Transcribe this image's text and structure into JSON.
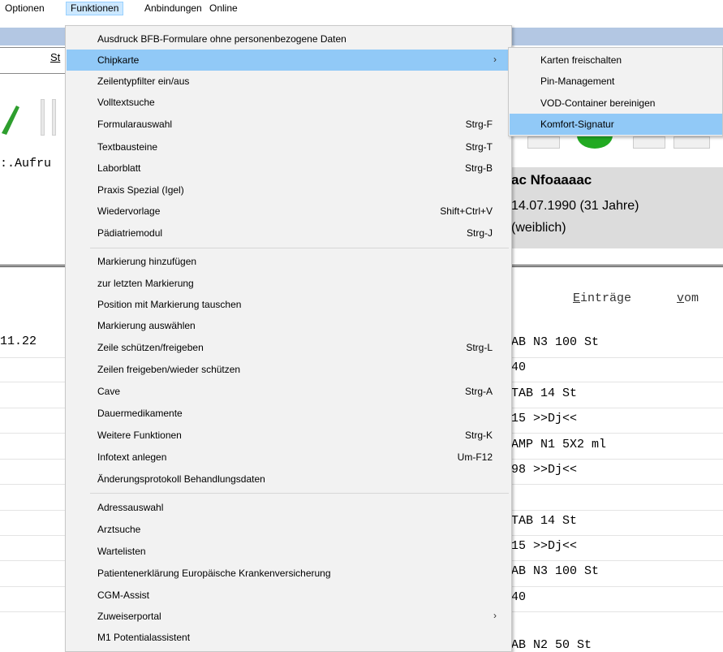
{
  "menubar": {
    "items": [
      {
        "label": "Optionen"
      },
      {
        "label": "Funktionen"
      },
      {
        "label": "Anbindungen"
      },
      {
        "label": "Online"
      }
    ]
  },
  "background": {
    "st_label": "St",
    "aufruf_text": ":.Aufru",
    "patient_name": "ac Nfoaaaac",
    "patient_dob": "14.07.1990 (31 Jahre)",
    "patient_sex": "(weiblich)",
    "eintraege_first": "E",
    "eintraege_rest": "inträge",
    "vom_first": "v",
    "vom_rest": "om",
    "date_left": "11.22",
    "rows": [
      "AB N3 100 St",
      "40",
      "TAB 14 St",
      "15 >>Dj<<",
      "AMP N1 5X2 ml",
      "98 >>Dj<<",
      "TAB 14 St",
      "15 >>Dj<<",
      "AB N3 100 St",
      "40",
      "AB N2 50 St"
    ]
  },
  "dropdown": {
    "items": [
      {
        "label": "Ausdruck BFB-Formulare ohne personenbezogene Daten",
        "shortcut": "",
        "submenu": false
      },
      {
        "label": "Chipkarte",
        "shortcut": "",
        "submenu": true
      },
      {
        "label": "Zeilentypfilter ein/aus",
        "shortcut": "",
        "submenu": false
      },
      {
        "label": "Volltextsuche",
        "shortcut": "",
        "submenu": false
      },
      {
        "label": "Formularauswahl",
        "shortcut": "Strg-F",
        "submenu": false
      },
      {
        "label": "Textbausteine",
        "shortcut": "Strg-T",
        "submenu": false
      },
      {
        "label": "Laborblatt",
        "shortcut": "Strg-B",
        "submenu": false
      },
      {
        "label": "Praxis Spezial (Igel)",
        "shortcut": "",
        "submenu": false
      },
      {
        "label": "Wiedervorlage",
        "shortcut": "Shift+Ctrl+V",
        "submenu": false
      },
      {
        "label": "Pädiatriemodul",
        "shortcut": "Strg-J",
        "submenu": false
      },
      {
        "label": "Markierung hinzufügen",
        "shortcut": "",
        "submenu": false
      },
      {
        "label": "zur letzten Markierung",
        "shortcut": "",
        "submenu": false
      },
      {
        "label": "Position mit Markierung tauschen",
        "shortcut": "",
        "submenu": false
      },
      {
        "label": "Markierung auswählen",
        "shortcut": "",
        "submenu": false
      },
      {
        "label": "Zeile schützen/freigeben",
        "shortcut": "Strg-L",
        "submenu": false
      },
      {
        "label": "Zeilen freigeben/wieder schützen",
        "shortcut": "",
        "submenu": false
      },
      {
        "label": "Cave",
        "shortcut": "Strg-A",
        "submenu": false
      },
      {
        "label": "Dauermedikamente",
        "shortcut": "",
        "submenu": false
      },
      {
        "label": "Weitere Funktionen",
        "shortcut": "Strg-K",
        "submenu": false
      },
      {
        "label": "Infotext anlegen",
        "shortcut": "Um-F12",
        "submenu": false
      },
      {
        "label": "Änderungsprotokoll Behandlungsdaten",
        "shortcut": "",
        "submenu": false
      },
      {
        "label": "Adressauswahl",
        "shortcut": "",
        "submenu": false
      },
      {
        "label": "Arztsuche",
        "shortcut": "",
        "submenu": false
      },
      {
        "label": "Wartelisten",
        "shortcut": "",
        "submenu": false
      },
      {
        "label": "Patientenerklärung Europäische Krankenversicherung",
        "shortcut": "",
        "submenu": false
      },
      {
        "label": "CGM-Assist",
        "shortcut": "",
        "submenu": false
      },
      {
        "label": "Zuweiserportal",
        "shortcut": "",
        "submenu": true
      },
      {
        "label": "M1 Potentialassistent",
        "shortcut": "",
        "submenu": false
      }
    ]
  },
  "submenu": {
    "items": [
      {
        "label": "Karten freischalten"
      },
      {
        "label": "Pin-Management"
      },
      {
        "label": "VOD-Container bereinigen"
      },
      {
        "label": "Komfort-Signatur"
      }
    ]
  },
  "colors": {
    "highlight": "#91c9f7",
    "menubar_active": "#cce8ff",
    "menu_bg": "#f2f2f2"
  },
  "icons": {
    "submenu_arrow": "›"
  }
}
